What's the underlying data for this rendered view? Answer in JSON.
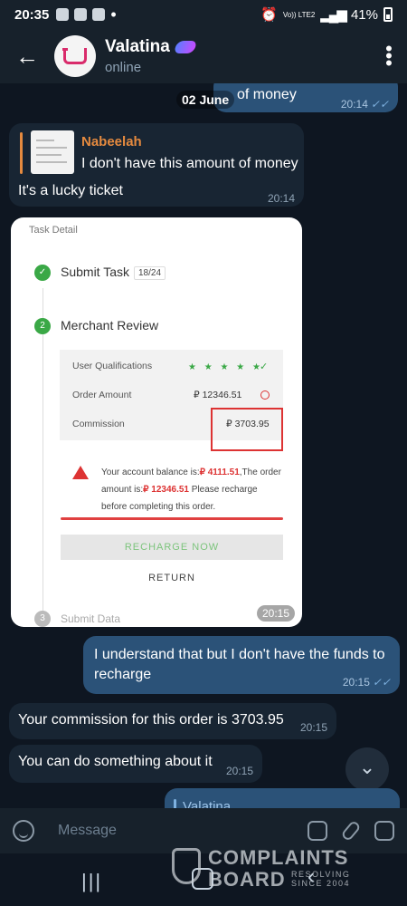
{
  "status_bar": {
    "time": "20:35",
    "network": "Vo)) LTE2",
    "battery": "41%"
  },
  "header": {
    "contact_name": "Valatina",
    "status": "online"
  },
  "chat": {
    "date_separator": "02 June",
    "partial_out": {
      "text": "of money",
      "time": "20:14"
    },
    "reply_msg": {
      "reply_author": "Nabeelah",
      "reply_text": "I don't have this amount of money",
      "text": "It's a lucky ticket",
      "time": "20:14"
    },
    "screenshot": {
      "title": "Task Detail",
      "step1_label": "Submit Task",
      "step1_count": "18/24",
      "step2_number": "2",
      "step2_label": "Merchant Review",
      "row1_label": "User Qualifications",
      "row1_value": "★ ★ ★ ★ ★",
      "row1_check": "✓",
      "row2_label": "Order Amount",
      "row2_value": "₽ 12346.51",
      "row3_label": "Commission",
      "row3_value": "₽ 3703.95",
      "warn_pre": "Your account balance is:",
      "warn_balance": "₽ 4111.51",
      "warn_mid": ",The order amount is:",
      "warn_amount": "₽ 12346.51",
      "warn_post": " Please recharge before completing this order.",
      "recharge_label": "RECHARGE NOW",
      "return_label": "RETURN",
      "step3_number": "3",
      "step3_label": "Submit Data",
      "time": "20:15"
    },
    "out_msg": {
      "text": "I understand that but I don't have the funds to recharge",
      "time": "20:15"
    },
    "in_msg1": {
      "text": "Your commission for this order is 3703.95",
      "time": "20:15"
    },
    "in_msg2": {
      "text": "You can do something about it",
      "time": "20:15"
    },
    "partial_out_bottom": {
      "text": "Valatina"
    }
  },
  "input_bar": {
    "placeholder": "Message"
  },
  "watermark": {
    "line1": "COMPLAINTS",
    "line2": "BOARD",
    "tag1": "RESOLVING",
    "tag2": "SINCE 2004"
  },
  "colors": {
    "background": "#0e1621",
    "incoming_bubble": "#182533",
    "outgoing_bubble": "#2b5278",
    "reply_accent": "#e58a3f",
    "highlight_red": "#d33333"
  },
  "icons": [
    "back-arrow-icon",
    "more-vert-icon",
    "emoji-icon",
    "sticker-icon",
    "attach-icon",
    "camera-icon",
    "scroll-down-icon"
  ]
}
